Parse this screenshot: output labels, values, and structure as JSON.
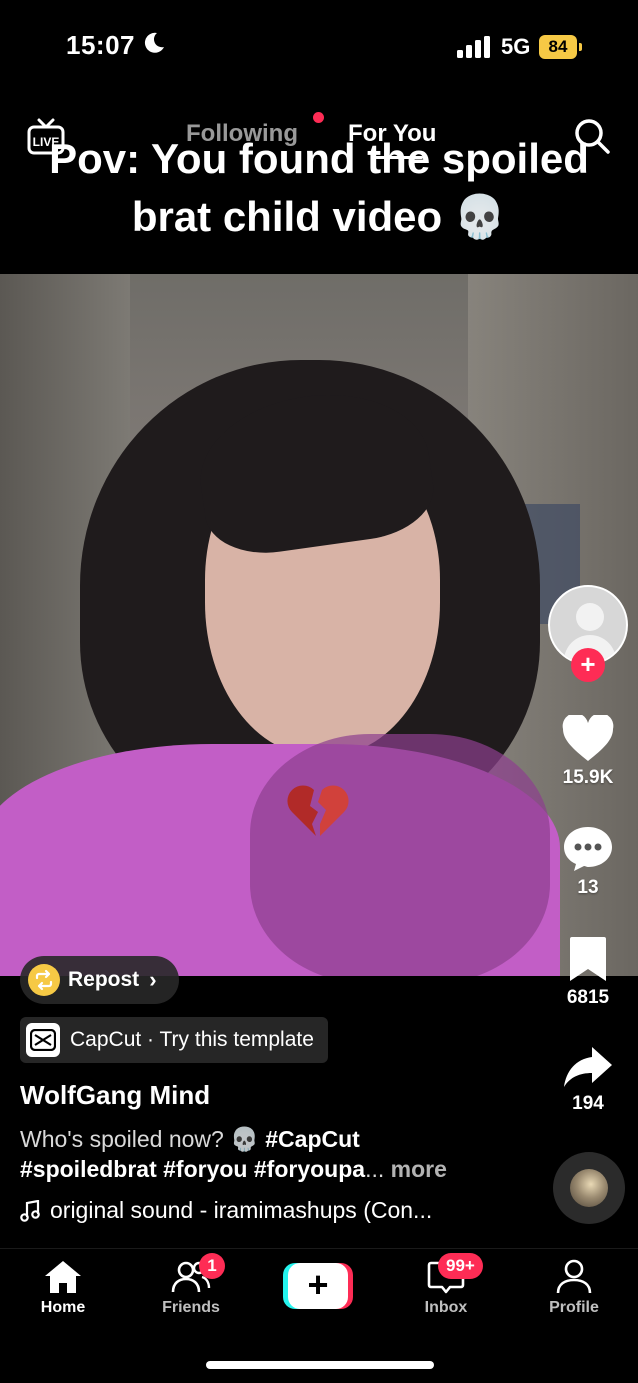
{
  "status_bar": {
    "time": "15:07",
    "network": "5G",
    "battery": "84"
  },
  "caption": {
    "line1": "Pov: You found the spoiled",
    "line2": "brat child video 💀"
  },
  "top_nav": {
    "following": "Following",
    "for_you": "For You",
    "live_label": "LIVE"
  },
  "overlay_emoji": "💔",
  "actions": {
    "likes": "15.9K",
    "comments": "13",
    "saves": "6815",
    "shares": "194"
  },
  "repost": {
    "label": "Repost",
    "chevron": "›"
  },
  "capcut": {
    "label": "CapCut · Try this template"
  },
  "post": {
    "author": "WolfGang Mind",
    "desc_plain": "Who's spoiled now? 💀 ",
    "desc_tag1": "#CapCut",
    "desc_tags2": "#spoiledbrat #foryou #foryoupa",
    "desc_ellipsis": "... ",
    "more": "more",
    "sound": "original sound - iramimashups (Con..."
  },
  "tabbar": {
    "home": "Home",
    "friends": "Friends",
    "friends_badge": "1",
    "create": "+",
    "inbox": "Inbox",
    "inbox_badge": "99+",
    "profile": "Profile"
  },
  "colors": {
    "accent": "#fe2c55",
    "cyan": "#25f4ee",
    "battery": "#f6c945"
  }
}
